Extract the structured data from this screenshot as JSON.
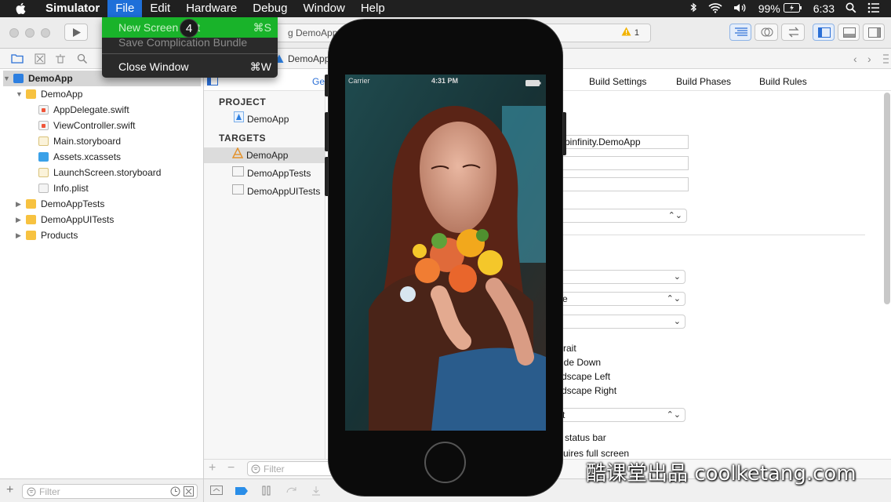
{
  "menubar": {
    "app": "Simulator",
    "items": [
      "File",
      "Edit",
      "Hardware",
      "Debug",
      "Window",
      "Help"
    ],
    "battery": "99%",
    "time": "6:33"
  },
  "toolbar": {
    "activity_text": "g DemoApp o",
    "warning_count": "1"
  },
  "jumpbar": {
    "crumb": "DemoApp"
  },
  "file_menu": {
    "items": [
      {
        "label": "New Screen",
        "tail": "t",
        "shortcut": "⌘S"
      },
      {
        "label": "Save Complication Bundle",
        "shortcut": ""
      },
      {
        "label": "Close Window",
        "shortcut": "⌘W"
      }
    ]
  },
  "click_badge": "4",
  "navigator": {
    "items": [
      {
        "label": "DemoApp",
        "level": 0,
        "icon": "project-icon",
        "expanded": true
      },
      {
        "label": "DemoApp",
        "level": 1,
        "icon": "folder-icon",
        "expanded": true
      },
      {
        "label": "AppDelegate.swift",
        "level": 2,
        "icon": "swift-file-icon"
      },
      {
        "label": "ViewController.swift",
        "level": 2,
        "icon": "swift-file-icon"
      },
      {
        "label": "Main.storyboard",
        "level": 2,
        "icon": "storyboard-icon"
      },
      {
        "label": "Assets.xcassets",
        "level": 2,
        "icon": "assets-icon"
      },
      {
        "label": "LaunchScreen.storyboard",
        "level": 2,
        "icon": "storyboard-icon"
      },
      {
        "label": "Info.plist",
        "level": 2,
        "icon": "plist-icon"
      },
      {
        "label": "DemoAppTests",
        "level": 1,
        "icon": "folder-icon",
        "expanded": false
      },
      {
        "label": "DemoAppUITests",
        "level": 1,
        "icon": "folder-icon",
        "expanded": false
      },
      {
        "label": "Products",
        "level": 1,
        "icon": "folder-icon",
        "expanded": false
      }
    ],
    "filter_placeholder": "Filter"
  },
  "editor": {
    "tab_partial": "Ge",
    "tabs": [
      "Build Settings",
      "Build Phases",
      "Build Rules"
    ],
    "project_header": "PROJECT",
    "project_item": "DemoApp",
    "targets_header": "TARGETS",
    "targets": [
      "DemoApp",
      "DemoAppTests",
      "DemoAppUITests"
    ],
    "bundle_id_partial": "pinfinity.DemoApp",
    "orientation_partial": [
      "rait",
      "ide Down",
      "dscape Left",
      "dscape Right"
    ],
    "status_bar_partial": "status bar",
    "fullscreen_partial": "uires full screen",
    "popup_partial_1": "e",
    "popup_partial_2": "t",
    "filter_placeholder": "Filter"
  },
  "simulator": {
    "carrier": "Carrier",
    "time": "4:31 PM"
  },
  "watermark": "酷课堂出品 coolketang.com"
}
